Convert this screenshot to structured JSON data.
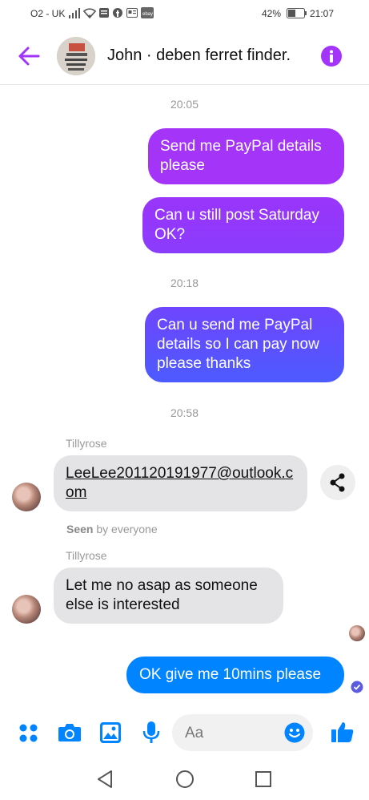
{
  "status_bar": {
    "carrier": "O2 - UK",
    "battery": "42%",
    "time": "21:07"
  },
  "header": {
    "title": "John · deben ferret finder."
  },
  "colors": {
    "accent": "#a334fa",
    "bubble_out_top": "#a033ff",
    "bubble_out_bottom": "#4a5cff",
    "bubble_out_last": "#0084ff",
    "bubble_in": "#e4e4e6",
    "icon_blue": "#0084ff"
  },
  "messages": {
    "ts1": "20:05",
    "m1": "Send me PayPal details please",
    "m2": "Can u still post Saturday OK?",
    "ts2": "20:18",
    "m3": "Can u send me PayPal details so I can pay now please thanks",
    "ts3": "20:58",
    "sender1": "Tillyrose",
    "m4": "LeeLee201120191977@outlook.com",
    "seen_bold": "Seen",
    "seen_rest": "by everyone",
    "sender2": "Tillyrose",
    "m5": "Let me no asap as someone else is interested",
    "m6": "OK give me 10mins please"
  },
  "composer": {
    "placeholder": "Aa"
  }
}
